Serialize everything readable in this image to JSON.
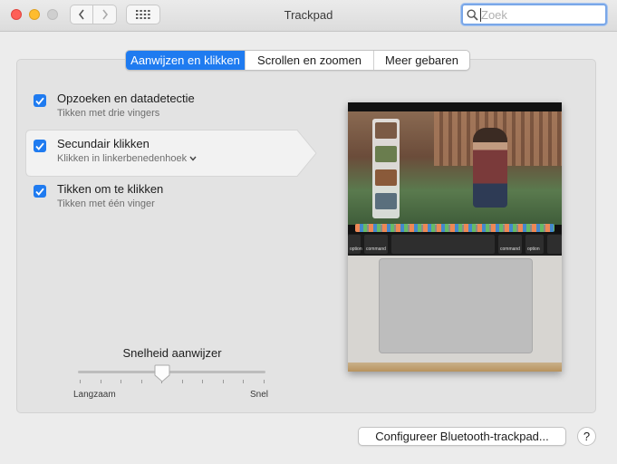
{
  "window": {
    "title": "Trackpad"
  },
  "search": {
    "placeholder": "Zoek"
  },
  "tabs": [
    {
      "label": "Aanwijzen en klikken",
      "active": true
    },
    {
      "label": "Scrollen en zoomen",
      "active": false
    },
    {
      "label": "Meer gebaren",
      "active": false
    }
  ],
  "options": [
    {
      "title": "Opzoeken en datadetectie",
      "subtitle": "Tikken met drie vingers",
      "checked": true
    },
    {
      "title": "Secundair klikken",
      "subtitle": "Klikken in linkerbenedenhoek",
      "checked": true,
      "has_dropdown": true,
      "selected": true
    },
    {
      "title": "Tikken om te klikken",
      "subtitle": "Tikken met één vinger",
      "checked": true
    }
  ],
  "speed": {
    "label": "Snelheid aanwijzer",
    "min_label": "Langzaam",
    "max_label": "Snel",
    "value_fraction": 0.45,
    "tick_count": 10
  },
  "preview": {
    "keys": {
      "left_option": "option",
      "left_command": "command",
      "right_command": "command",
      "right_option": "option"
    }
  },
  "footer": {
    "bluetooth_button": "Configureer Bluetooth-trackpad...",
    "help_button": "?"
  },
  "colors": {
    "accent": "#1f7bf0",
    "close": "#fe5f57",
    "minimize": "#febc2e"
  }
}
